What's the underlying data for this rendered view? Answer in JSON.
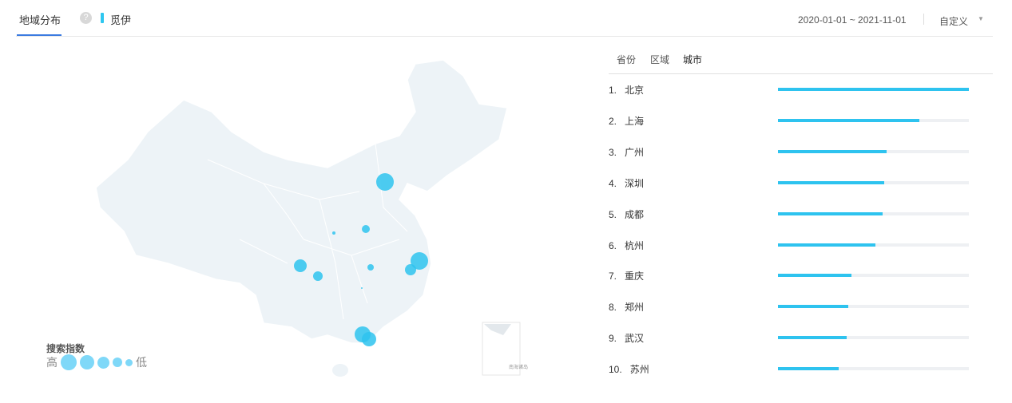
{
  "header": {
    "tab": "地域分布",
    "help": "?",
    "keyword": "觅伊",
    "date_range": "2020-01-01 ~ 2021-11-01",
    "range_mode": "自定义"
  },
  "subtabs": [
    "省份",
    "区域",
    "城市"
  ],
  "legend": {
    "title": "搜索指数",
    "high": "高",
    "low": "低"
  },
  "inset_label": "南海诸岛",
  "colors": {
    "accent": "#2ec3ef",
    "tab_underline": "#3b7be0",
    "map": "#edf3f7"
  },
  "ranking": [
    {
      "rank": "1.",
      "city": "北京",
      "value": 1.0
    },
    {
      "rank": "2.",
      "city": "上海",
      "value": 0.74
    },
    {
      "rank": "3.",
      "city": "广州",
      "value": 0.57
    },
    {
      "rank": "4.",
      "city": "深圳",
      "value": 0.556
    },
    {
      "rank": "5.",
      "city": "成都",
      "value": 0.55
    },
    {
      "rank": "6.",
      "city": "杭州",
      "value": 0.51
    },
    {
      "rank": "7.",
      "city": "重庆",
      "value": 0.385
    },
    {
      "rank": "8.",
      "city": "郑州",
      "value": 0.37
    },
    {
      "rank": "9.",
      "city": "武汉",
      "value": 0.36
    },
    {
      "rank": "10.",
      "city": "苏州",
      "value": 0.32
    }
  ]
}
